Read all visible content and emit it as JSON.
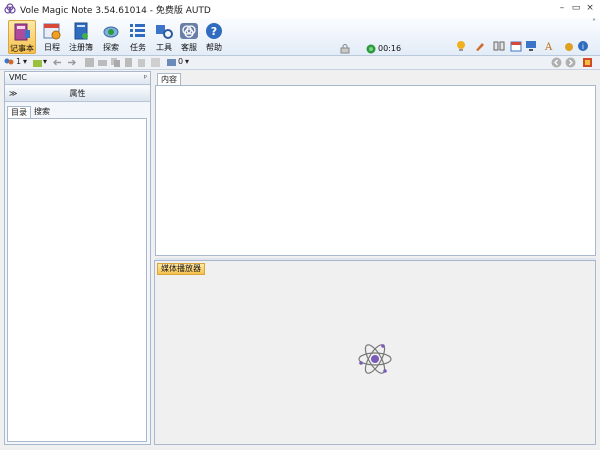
{
  "window": {
    "title": "Vole Magic Note  3.54.61014 - 免费版 AUTD",
    "controls": {
      "minimize": "–",
      "maximize": "▭",
      "close": "×"
    }
  },
  "ribbon": {
    "buttons": [
      {
        "id": "notebook",
        "label": "记事本",
        "icon": "notebook-icon",
        "active": true
      },
      {
        "id": "schedule",
        "label": "日程",
        "icon": "calendar-icon"
      },
      {
        "id": "register",
        "label": "注册簿",
        "icon": "register-book-icon"
      },
      {
        "id": "explore",
        "label": "探索",
        "icon": "explore-icon"
      },
      {
        "id": "task",
        "label": "任务",
        "icon": "task-list-icon"
      },
      {
        "id": "tools",
        "label": "工具",
        "icon": "tools-icon"
      },
      {
        "id": "customer",
        "label": "客服",
        "icon": "customer-service-icon"
      },
      {
        "id": "help",
        "label": "帮助",
        "icon": "help-icon"
      }
    ],
    "clock": "00:16",
    "expand_glyph": "˄"
  },
  "toolbar": {
    "user_count": "1",
    "media_count": "0",
    "dropdown_glyph": "▾"
  },
  "left_panel": {
    "header": "VMC",
    "pin_glyph": "ᵖ",
    "attributes_label": "属性",
    "collapse_glyph": "≫",
    "tabs": [
      {
        "label": "目录",
        "active": true
      },
      {
        "label": "搜索",
        "active": false
      }
    ]
  },
  "content": {
    "tab_label": "内容"
  },
  "media_player": {
    "tab_label": "媒体播放器"
  },
  "colors": {
    "accent": "#f7c14d",
    "ribbon_bg": "#e3ecf7",
    "border": "#a9b8cc"
  }
}
